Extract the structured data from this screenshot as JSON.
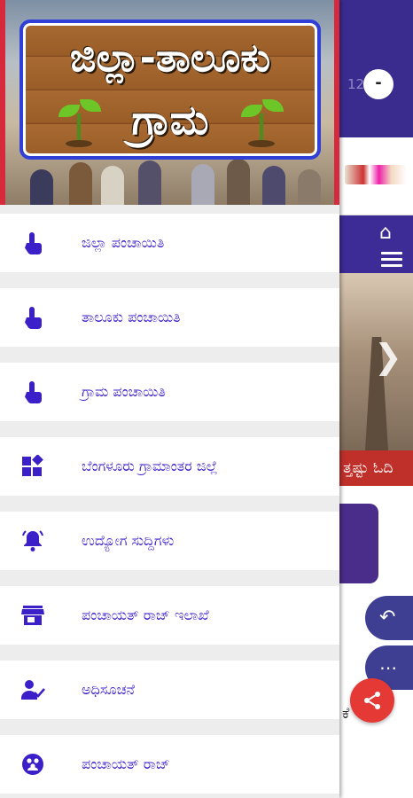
{
  "colors": {
    "accent": "#3b1fc9",
    "header_red": "#d62a3c",
    "purple_bar": "#3d2b96",
    "ribbon_red": "#c0302a",
    "fab_red": "#e53935"
  },
  "drawer": {
    "header": {
      "title_line1": "ಜಿಲ್ಲಾ-ತಾಲೂಕು",
      "title_line2": "ಗ್ರಾಮ"
    },
    "items": [
      {
        "label": "ಜಿಲ್ಲಾ ಪಂಚಾಯಿತಿ",
        "icon": "touch-app-icon"
      },
      {
        "label": "ತಾಲೂಕು ಪಂಚಾಯಿತಿ",
        "icon": "touch-app-icon"
      },
      {
        "label": "ಗ್ರಾಮ ಪಂಚಾಯಿತಿ",
        "icon": "touch-app-icon"
      },
      {
        "label": "ಬೆಂಗಳೂರು ಗ್ರಾಮಾಂತರ ಜಿಲ್ಲೆ",
        "icon": "widgets-icon"
      },
      {
        "label": "ಉದ್ಯೋಗ ಸುದ್ದಿಗಳು",
        "icon": "notification-bell-icon"
      },
      {
        "label": "ಪಂಚಾಯತ್ ರಾಜ್ ಇಲಾಖೆ",
        "icon": "storefront-icon"
      },
      {
        "label": "ಅಧಿಸೂಚನೆ",
        "icon": "person-check-icon"
      },
      {
        "label": "ಪಂಚಾಯತ್ ರಾಜ್",
        "icon": "group-icon"
      }
    ]
  },
  "background": {
    "time_fragment": "12",
    "avatar_button_symbol": "-",
    "ribbon_text": "ತ್ತಷ್ಟು ಓದಿ",
    "text_fragment": "ಕೆ"
  }
}
